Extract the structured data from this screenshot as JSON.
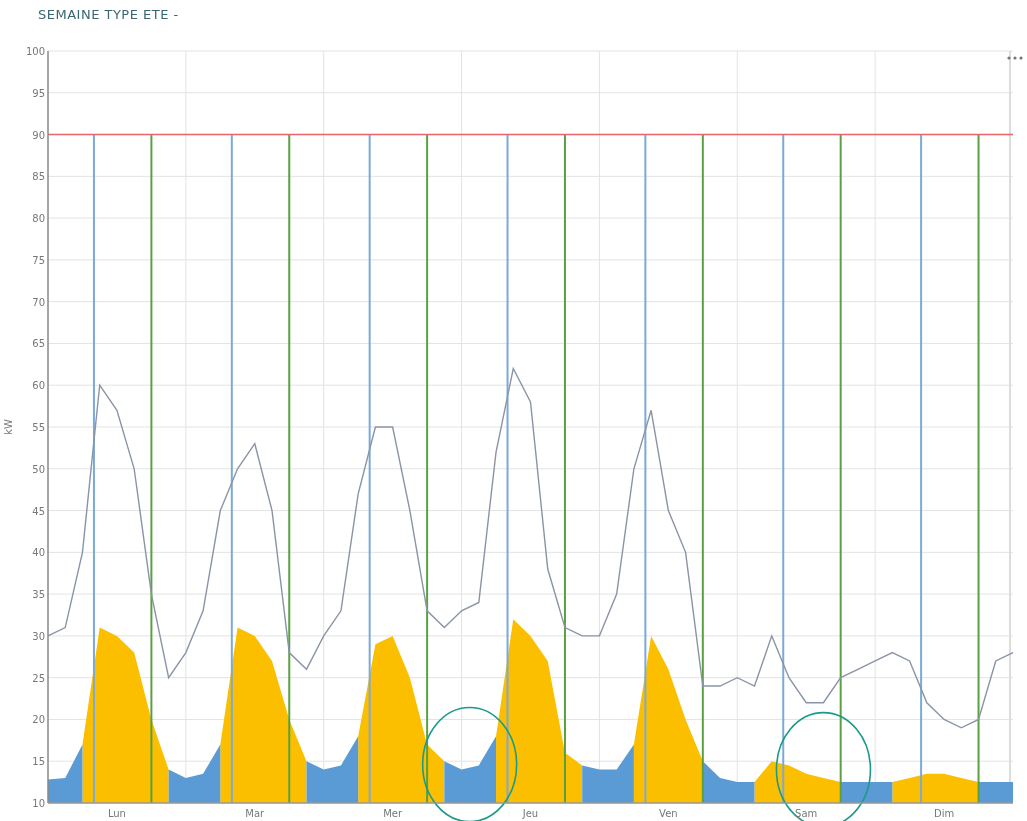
{
  "title": "SEMAINE TYPE ETE -",
  "chart_data": {
    "type": "area",
    "ylabel": "kW",
    "ylim": [
      10,
      100
    ],
    "categories": [
      null,
      null,
      null,
      null,
      "Lun",
      null,
      null,
      null,
      null,
      null,
      null,
      null,
      "Mar",
      null,
      null,
      null,
      null,
      null,
      null,
      null,
      "Mer",
      null,
      null,
      null,
      null,
      null,
      null,
      null,
      "Jeu",
      null,
      null,
      null,
      null,
      null,
      null,
      null,
      "Ven",
      null,
      null,
      null,
      null,
      null,
      null,
      null,
      "Sam",
      null,
      null,
      null,
      null,
      null,
      null,
      null,
      "Dim",
      null,
      null,
      null,
      null
    ],
    "yticks": [
      10,
      15,
      20,
      25,
      30,
      35,
      40,
      45,
      50,
      55,
      60,
      65,
      70,
      75,
      80,
      85,
      90,
      95,
      100
    ],
    "series": [
      {
        "type": "line",
        "color": "#8a94a6",
        "values": [
          30,
          31,
          40,
          60,
          57,
          50,
          35,
          25,
          28,
          33,
          45,
          50,
          53,
          45,
          28,
          26,
          30,
          33,
          47,
          55,
          55,
          45,
          33,
          31,
          33,
          34,
          52,
          62,
          58,
          38,
          31,
          30,
          30,
          35,
          50,
          57,
          45,
          40,
          24,
          24,
          25,
          24,
          30,
          25,
          22,
          22,
          25,
          26,
          27,
          28,
          27,
          22,
          20,
          19,
          20,
          27,
          28
        ]
      },
      {
        "color": "#fcbf00",
        "values": [
          null,
          null,
          17,
          31,
          30,
          28,
          20,
          14,
          null,
          null,
          17,
          31,
          30,
          27,
          20,
          15,
          null,
          null,
          18,
          29,
          30,
          25,
          17,
          15,
          null,
          null,
          18,
          32,
          30,
          27,
          16,
          14.5,
          null,
          null,
          17,
          30,
          26,
          20,
          15,
          null,
          null,
          12.5,
          15,
          14.5,
          13.5,
          13,
          12.5,
          null,
          null,
          12.5,
          13,
          13.5,
          13.5,
          13,
          12.5,
          null,
          null
        ]
      },
      {
        "color": "#5b9bd5",
        "values": [
          12.8,
          13,
          17,
          null,
          null,
          null,
          null,
          14,
          13,
          13.5,
          17,
          null,
          null,
          null,
          null,
          15,
          14,
          14.5,
          18,
          null,
          null,
          null,
          null,
          15,
          14,
          14.5,
          18,
          null,
          null,
          null,
          null,
          14.5,
          14,
          14,
          17,
          null,
          null,
          null,
          15,
          13,
          12.5,
          12.5,
          null,
          null,
          null,
          null,
          12.5,
          12.5,
          12.5,
          12.5,
          null,
          null,
          null,
          null,
          12.5,
          12.5,
          12.5
        ]
      }
    ],
    "grid": true,
    "ref_lines": [
      {
        "axis": "y",
        "value": 90,
        "color": "#e8666b"
      }
    ]
  }
}
